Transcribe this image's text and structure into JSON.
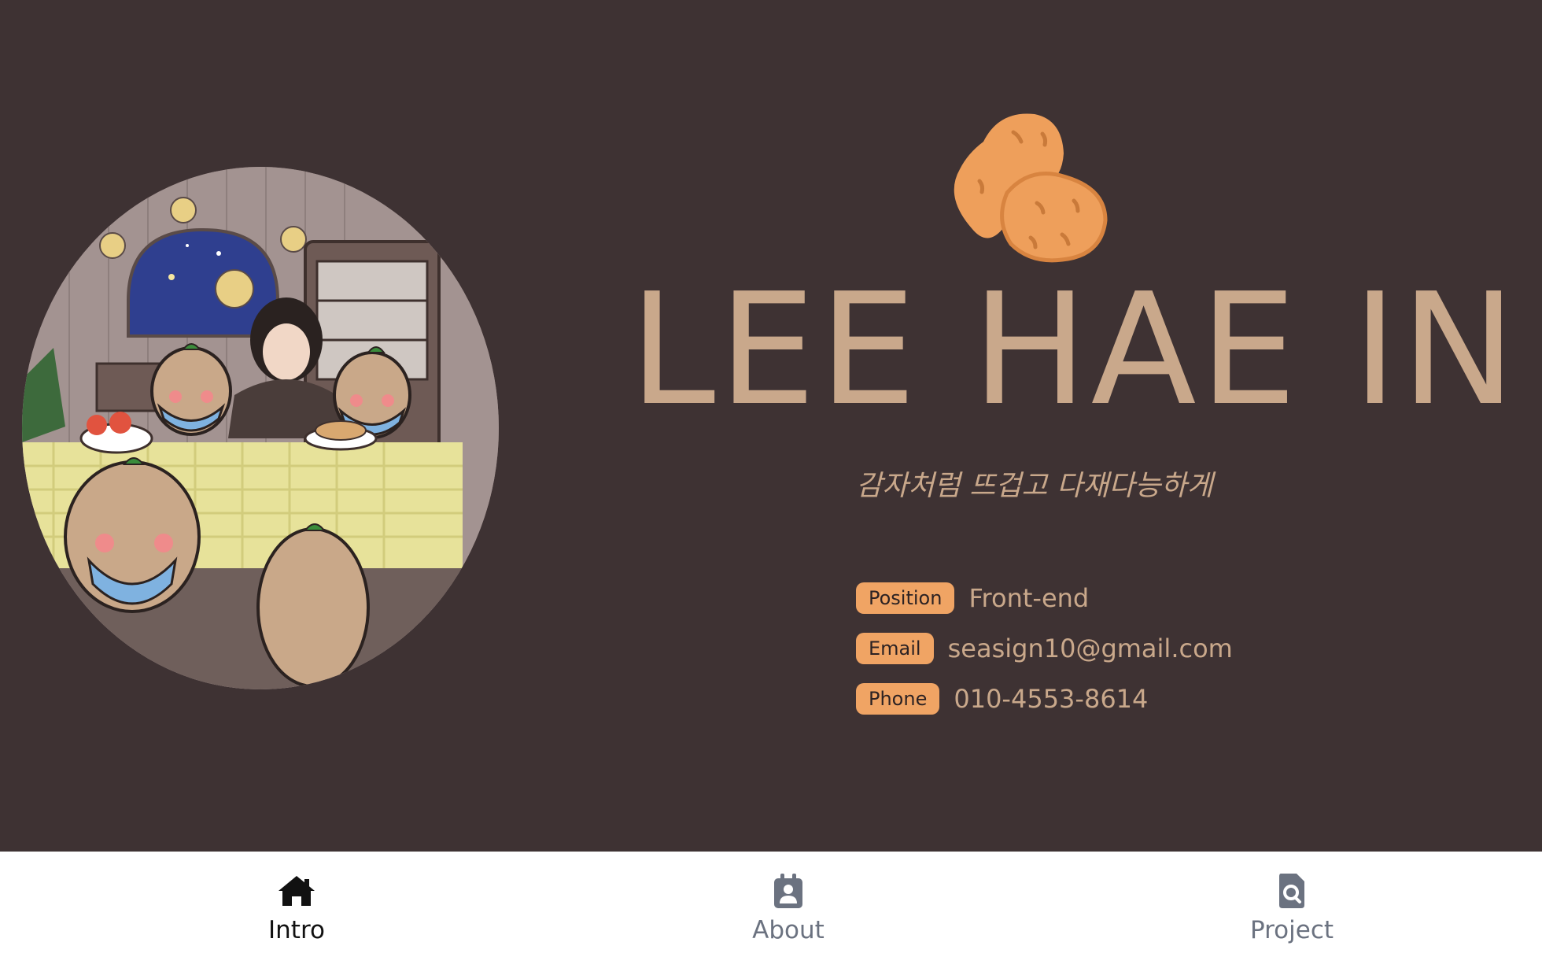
{
  "profile": {
    "name": "LEE HAE IN",
    "tagline": "감자처럼 뜨겁고 다재다능하게",
    "logo_icon": "potato-icon",
    "photo_alt": "profile-photo"
  },
  "info": [
    {
      "label": "Position",
      "value": "Front-end"
    },
    {
      "label": "Email",
      "value": "seasign10@gmail.com"
    },
    {
      "label": "Phone",
      "value": "010-4553-8614"
    }
  ],
  "nav": {
    "items": [
      {
        "label": "Intro",
        "icon": "home-icon",
        "active": true
      },
      {
        "label": "About",
        "icon": "contact-card-icon",
        "active": false
      },
      {
        "label": "Project",
        "icon": "file-search-icon",
        "active": false
      }
    ]
  },
  "colors": {
    "background": "#3e3233",
    "accent_text": "#c9a88b",
    "badge": "#f0a464",
    "nav_bg": "#ffffff",
    "nav_active": "#111111",
    "nav_inactive": "#6b7280"
  }
}
